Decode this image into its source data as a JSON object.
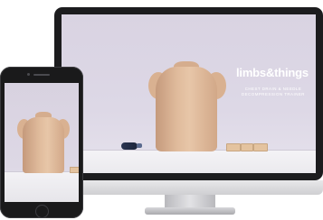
{
  "monitor": {
    "brand": "limbs&things",
    "tagline_line1": "CHEST DRAIN & NEEDLE",
    "tagline_line2": "DECOMPRESSION TRAINER"
  },
  "colors": {
    "bezel": "#1c1c1e",
    "screen_bg": "#d9d3e2",
    "torso": "#e0bb9c",
    "brand_text": "#ffffff"
  }
}
